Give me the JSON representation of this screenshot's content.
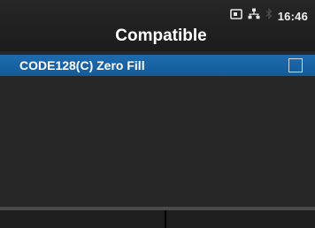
{
  "status": {
    "icons": [
      "sd-card-icon",
      "network-icon",
      "bluetooth-icon"
    ],
    "time": "16:46"
  },
  "header": {
    "title": "Compatible"
  },
  "list": {
    "items": [
      {
        "label": "CODE128(C) Zero Fill",
        "checked": false,
        "selected": true
      }
    ]
  },
  "footer": {
    "buttons": [
      {
        "label": ""
      },
      {
        "label": ""
      }
    ]
  },
  "colors": {
    "selection": "#1a64a6",
    "background": "#272727",
    "header": "#1f1f1f"
  }
}
